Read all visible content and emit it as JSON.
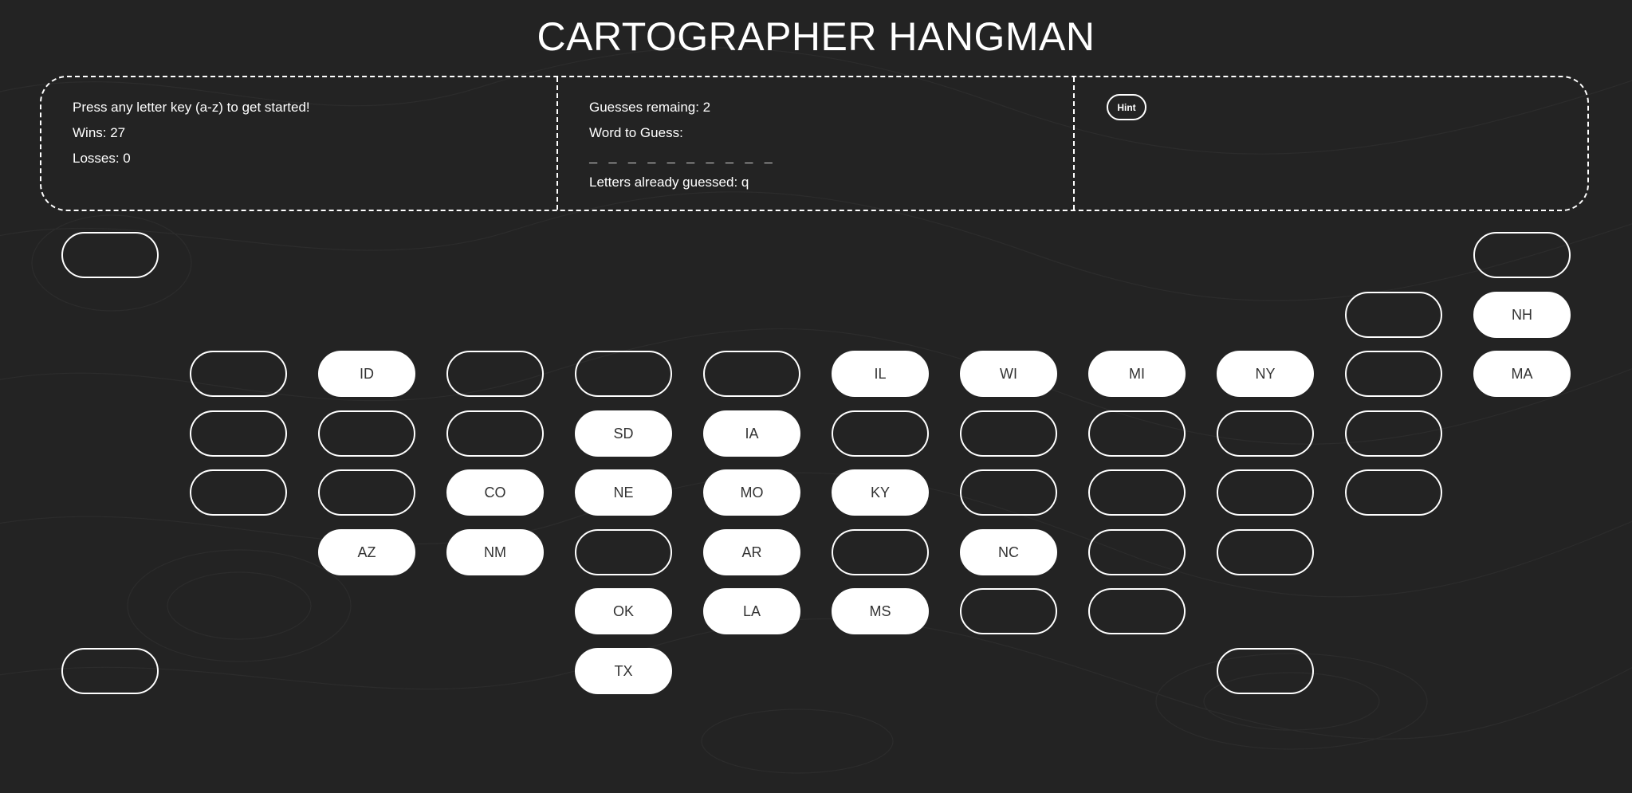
{
  "game": {
    "title": "CARTOGRAPHER HANGMAN"
  },
  "status": {
    "instructions": "Press any letter key (a-z) to get started!",
    "wins": "Wins: 27",
    "losses": "Losses: 0"
  },
  "word": {
    "guesses_remaining": "Guesses remaing: 2",
    "label": "Word to Guess:",
    "blanks": "_ _ _ _ _ _ _ _ _ _",
    "letters_guessed": "Letters already guessed: q"
  },
  "hint": {
    "label": "Hint"
  },
  "colors": {
    "background": "#232323",
    "foreground": "#ffffff",
    "tile_text": "#333333"
  },
  "map": {
    "tiles": [
      {
        "row": 0,
        "col": 0,
        "abbr": "",
        "revealed": false
      },
      {
        "row": 0,
        "col": 11,
        "abbr": "",
        "revealed": false
      },
      {
        "row": 1,
        "col": 10,
        "abbr": "",
        "revealed": false
      },
      {
        "row": 1,
        "col": 11,
        "abbr": "NH",
        "revealed": true
      },
      {
        "row": 2,
        "col": 1,
        "abbr": "",
        "revealed": false
      },
      {
        "row": 2,
        "col": 2,
        "abbr": "ID",
        "revealed": true
      },
      {
        "row": 2,
        "col": 3,
        "abbr": "",
        "revealed": false
      },
      {
        "row": 2,
        "col": 4,
        "abbr": "",
        "revealed": false
      },
      {
        "row": 2,
        "col": 5,
        "abbr": "",
        "revealed": false
      },
      {
        "row": 2,
        "col": 6,
        "abbr": "IL",
        "revealed": true
      },
      {
        "row": 2,
        "col": 7,
        "abbr": "WI",
        "revealed": true
      },
      {
        "row": 2,
        "col": 8,
        "abbr": "MI",
        "revealed": true
      },
      {
        "row": 2,
        "col": 9,
        "abbr": "NY",
        "revealed": true
      },
      {
        "row": 2,
        "col": 10,
        "abbr": "",
        "revealed": false
      },
      {
        "row": 2,
        "col": 11,
        "abbr": "MA",
        "revealed": true
      },
      {
        "row": 3,
        "col": 1,
        "abbr": "",
        "revealed": false
      },
      {
        "row": 3,
        "col": 2,
        "abbr": "",
        "revealed": false
      },
      {
        "row": 3,
        "col": 3,
        "abbr": "",
        "revealed": false
      },
      {
        "row": 3,
        "col": 4,
        "abbr": "SD",
        "revealed": true
      },
      {
        "row": 3,
        "col": 5,
        "abbr": "IA",
        "revealed": true
      },
      {
        "row": 3,
        "col": 6,
        "abbr": "",
        "revealed": false
      },
      {
        "row": 3,
        "col": 7,
        "abbr": "",
        "revealed": false
      },
      {
        "row": 3,
        "col": 8,
        "abbr": "",
        "revealed": false
      },
      {
        "row": 3,
        "col": 9,
        "abbr": "",
        "revealed": false
      },
      {
        "row": 3,
        "col": 10,
        "abbr": "",
        "revealed": false
      },
      {
        "row": 4,
        "col": 1,
        "abbr": "",
        "revealed": false
      },
      {
        "row": 4,
        "col": 2,
        "abbr": "",
        "revealed": false
      },
      {
        "row": 4,
        "col": 3,
        "abbr": "CO",
        "revealed": true
      },
      {
        "row": 4,
        "col": 4,
        "abbr": "NE",
        "revealed": true
      },
      {
        "row": 4,
        "col": 5,
        "abbr": "MO",
        "revealed": true
      },
      {
        "row": 4,
        "col": 6,
        "abbr": "KY",
        "revealed": true
      },
      {
        "row": 4,
        "col": 7,
        "abbr": "",
        "revealed": false
      },
      {
        "row": 4,
        "col": 8,
        "abbr": "",
        "revealed": false
      },
      {
        "row": 4,
        "col": 9,
        "abbr": "",
        "revealed": false
      },
      {
        "row": 4,
        "col": 10,
        "abbr": "",
        "revealed": false
      },
      {
        "row": 5,
        "col": 2,
        "abbr": "AZ",
        "revealed": true
      },
      {
        "row": 5,
        "col": 3,
        "abbr": "NM",
        "revealed": true
      },
      {
        "row": 5,
        "col": 4,
        "abbr": "",
        "revealed": false
      },
      {
        "row": 5,
        "col": 5,
        "abbr": "AR",
        "revealed": true
      },
      {
        "row": 5,
        "col": 6,
        "abbr": "",
        "revealed": false
      },
      {
        "row": 5,
        "col": 7,
        "abbr": "NC",
        "revealed": true
      },
      {
        "row": 5,
        "col": 8,
        "abbr": "",
        "revealed": false
      },
      {
        "row": 5,
        "col": 9,
        "abbr": "",
        "revealed": false
      },
      {
        "row": 6,
        "col": 4,
        "abbr": "OK",
        "revealed": true
      },
      {
        "row": 6,
        "col": 5,
        "abbr": "LA",
        "revealed": true
      },
      {
        "row": 6,
        "col": 6,
        "abbr": "MS",
        "revealed": true
      },
      {
        "row": 6,
        "col": 7,
        "abbr": "",
        "revealed": false
      },
      {
        "row": 6,
        "col": 8,
        "abbr": "",
        "revealed": false
      },
      {
        "row": 7,
        "col": 0,
        "abbr": "",
        "revealed": false
      },
      {
        "row": 7,
        "col": 4,
        "abbr": "TX",
        "revealed": true
      },
      {
        "row": 7,
        "col": 9,
        "abbr": "",
        "revealed": false
      }
    ]
  }
}
